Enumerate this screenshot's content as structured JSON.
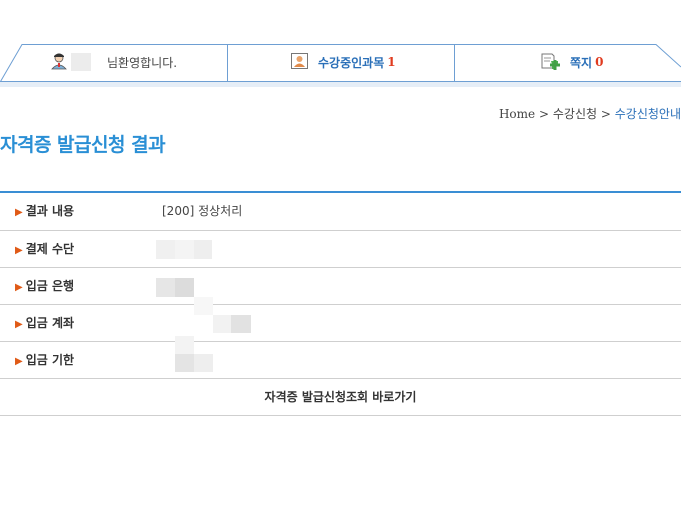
{
  "topbar": {
    "greeting": "님환영합니다.",
    "courses_label": "수강중인과목",
    "courses_count": "1",
    "notes_label": "쪽지",
    "notes_count": "0"
  },
  "breadcrumb": {
    "home": "Home",
    "sep1": ">",
    "section": "수강신청",
    "sep2": ">",
    "current": "수강신청안내"
  },
  "page": {
    "title": "자격증 발급신청 결과"
  },
  "result": {
    "rows": [
      {
        "label": "결과 내용",
        "value": "[200] 정상처리"
      },
      {
        "label": "결제 수단",
        "value": ""
      },
      {
        "label": "입금 은행",
        "value": ""
      },
      {
        "label": "입금 계좌",
        "value": ""
      },
      {
        "label": "입금 기한",
        "value": ""
      }
    ],
    "action_label": "자격증 발급신청조회 바로가기"
  },
  "colors": {
    "accent": "#2a8fd5",
    "tab_line": "#5b9bd5",
    "highlight": "#e05a16"
  },
  "icons": [
    "user-avatar-icon",
    "course-book-icon",
    "message-edit-icon",
    "triangle-bullet-icon"
  ]
}
